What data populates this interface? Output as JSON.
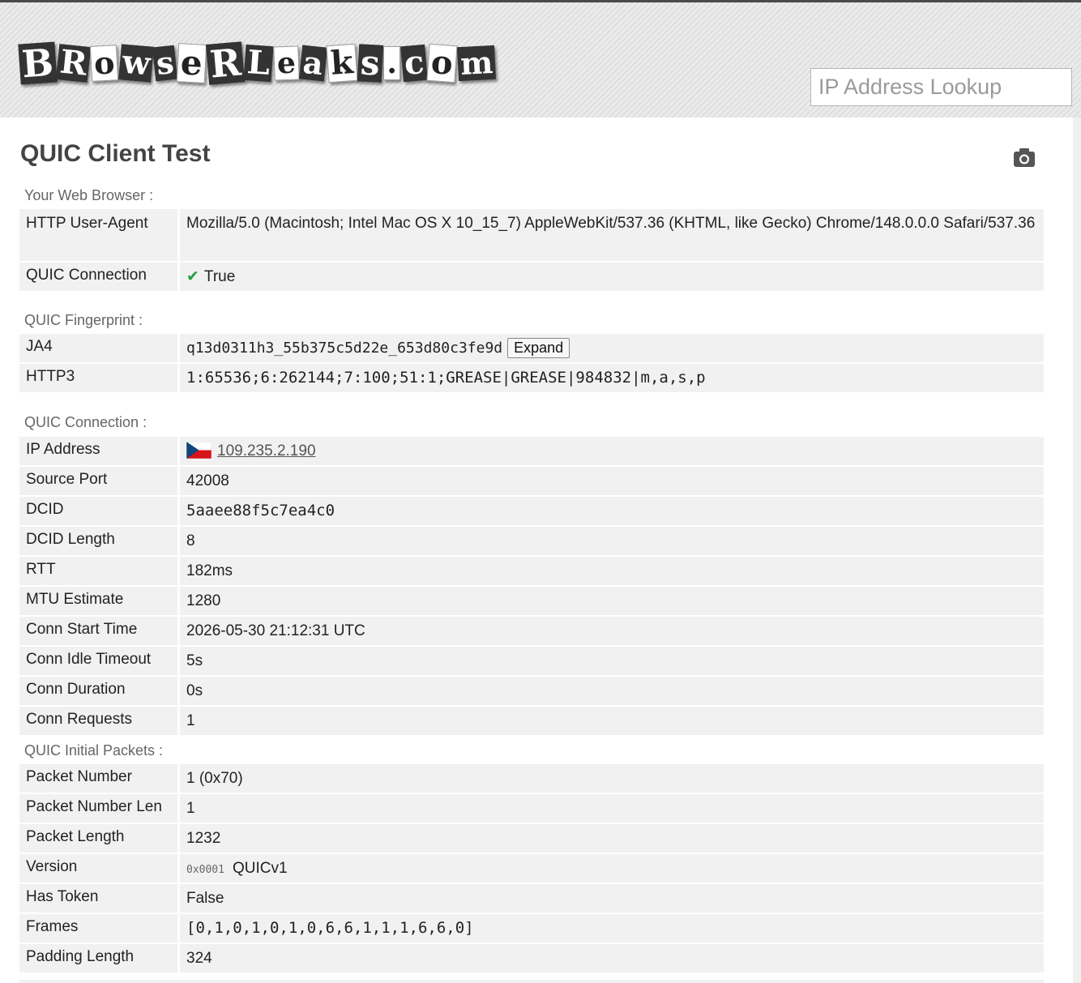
{
  "header": {
    "logo_letters": [
      "B",
      "R",
      "o",
      "w",
      "s",
      "e",
      "R",
      "L",
      "e",
      "a",
      "k",
      "s",
      ".",
      "c",
      "o",
      "m"
    ],
    "search_placeholder": "IP Address Lookup"
  },
  "page": {
    "title": "QUIC Client Test"
  },
  "browser": {
    "label": "Your Web Browser :",
    "rows": [
      {
        "key": "HTTP User-Agent",
        "value": "Mozilla/5.0 (Macintosh; Intel Mac OS X 10_15_7) AppleWebKit/537.36 (KHTML, like Gecko) Chrome/148.0.0.0 Safari/537.36"
      },
      {
        "key": "QUIC Connection",
        "value": "True"
      }
    ]
  },
  "fingerprint": {
    "label": "QUIC Fingerprint :",
    "ja4_key": "JA4",
    "ja4_value": "q13d0311h3_55b375c5d22e_653d80c3fe9d",
    "expand_label": "Expand",
    "http3_key": "HTTP3",
    "http3_value": "1:65536;6:262144;7:100;51:1;GREASE|GREASE|984832|m,a,s,p"
  },
  "connection": {
    "label": "QUIC Connection :",
    "ip_key": "IP Address",
    "ip_value": "109.235.2.190",
    "rows": [
      {
        "key": "Source Port",
        "value": "42008"
      },
      {
        "key": "DCID",
        "value": "5aaee88f5c7ea4c0"
      },
      {
        "key": "DCID Length",
        "value": "8"
      },
      {
        "key": "RTT",
        "value": "182ms"
      },
      {
        "key": "MTU Estimate",
        "value": "1280"
      },
      {
        "key": "Conn Start Time",
        "value": "2026-05-30 21:12:31 UTC"
      },
      {
        "key": "Conn Idle Timeout",
        "value": "5s"
      },
      {
        "key": "Conn Duration",
        "value": "0s"
      },
      {
        "key": "Conn Requests",
        "value": "1"
      }
    ]
  },
  "initial_packets": {
    "label": "QUIC Initial Packets :",
    "rows": [
      {
        "key": "Packet Number",
        "value": "1 (0x70)"
      },
      {
        "key": "Packet Number Len",
        "value": "1"
      },
      {
        "key": "Packet Length",
        "value": "1232"
      }
    ],
    "version_key": "Version",
    "version_code": "0x0001",
    "version_name": "QUICv1",
    "rows2": [
      {
        "key": "Has Token",
        "value": "False"
      },
      {
        "key": "Frames",
        "value": "[0,1,0,1,0,1,0,6,6,1,1,1,6,6,0]"
      },
      {
        "key": "Padding Length",
        "value": "324"
      }
    ]
  }
}
